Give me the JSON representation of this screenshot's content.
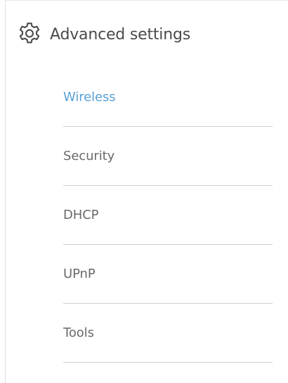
{
  "header": {
    "title": "Advanced settings",
    "icon": "gear-icon"
  },
  "menu": {
    "active_index": 0,
    "items": [
      {
        "label": "Wireless"
      },
      {
        "label": "Security"
      },
      {
        "label": "DHCP"
      },
      {
        "label": "UPnP"
      },
      {
        "label": "Tools"
      }
    ]
  },
  "colors": {
    "active": "#5aa0d6",
    "text": "#6a6a6a",
    "title": "#4a4a4a",
    "divider": "#cfcfcf"
  }
}
